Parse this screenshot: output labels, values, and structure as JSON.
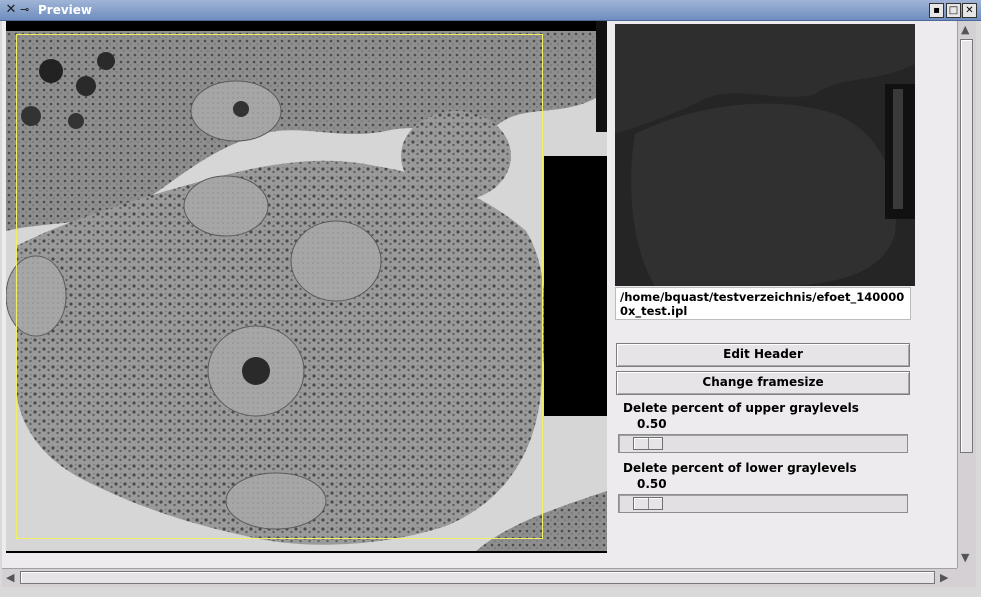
{
  "window": {
    "title": "Preview",
    "controls": [
      "minimize",
      "maximize",
      "close"
    ]
  },
  "thumbnail": {
    "file_path": "/home/bquast/testverzeichnis/efoet_1400000x_test.ipl"
  },
  "buttons": {
    "edit_header": "Edit Header",
    "change_framesize": "Change framesize"
  },
  "sliders": {
    "upper": {
      "label": "Delete percent of upper graylevels",
      "value": "0.50",
      "position_fraction": 0.05
    },
    "lower": {
      "label": "Delete percent of lower graylevels",
      "value": "0.50",
      "position_fraction": 0.05
    }
  },
  "colors": {
    "frame_rectangle": "#f0f060",
    "titlebar": "#7f9bc9",
    "client_bg": "#eeebee"
  },
  "icons": [
    "x-window-icon",
    "pin-icon",
    "minimize-icon",
    "maximize-icon",
    "close-icon",
    "scroll-up-icon",
    "scroll-down-icon",
    "scroll-left-icon",
    "scroll-right-icon"
  ]
}
